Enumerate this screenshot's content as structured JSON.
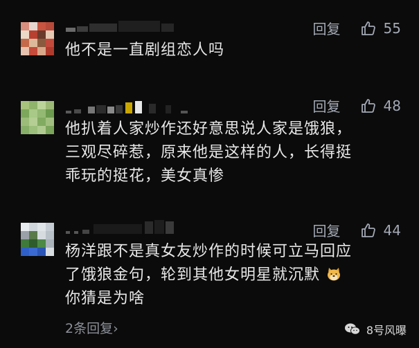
{
  "comments": [
    {
      "reply_label": "回复",
      "likes": "55",
      "text_lines": [
        "他不是一直剧组恋人吗"
      ]
    },
    {
      "reply_label": "回复",
      "likes": "48",
      "text_lines": [
        "他扒着人家炒作还好意思说人家是饿狼，",
        "三观尽碎惹，原来他是这样的人，长得挺",
        "乖玩的挺花，美女真惨"
      ]
    },
    {
      "reply_label": "回复",
      "likes": "44",
      "text_lines": [
        "杨洋跟不是真女友炒作的时候可立马回应",
        "了饿狼金句，轮到其他女明星就沉默",
        "你猜是为啥"
      ]
    }
  ],
  "replies_link": "2条回复",
  "replies_chevron": "›",
  "watermark": "8号风曝",
  "icons": {
    "like": "thumbs-up-icon",
    "emoji": "doge-emoji-icon",
    "watermark_logo": "wechat-icon"
  },
  "colors": {
    "background": "#0b0b0b",
    "text": "#e8e8e8",
    "meta": "#a3a9b5"
  }
}
